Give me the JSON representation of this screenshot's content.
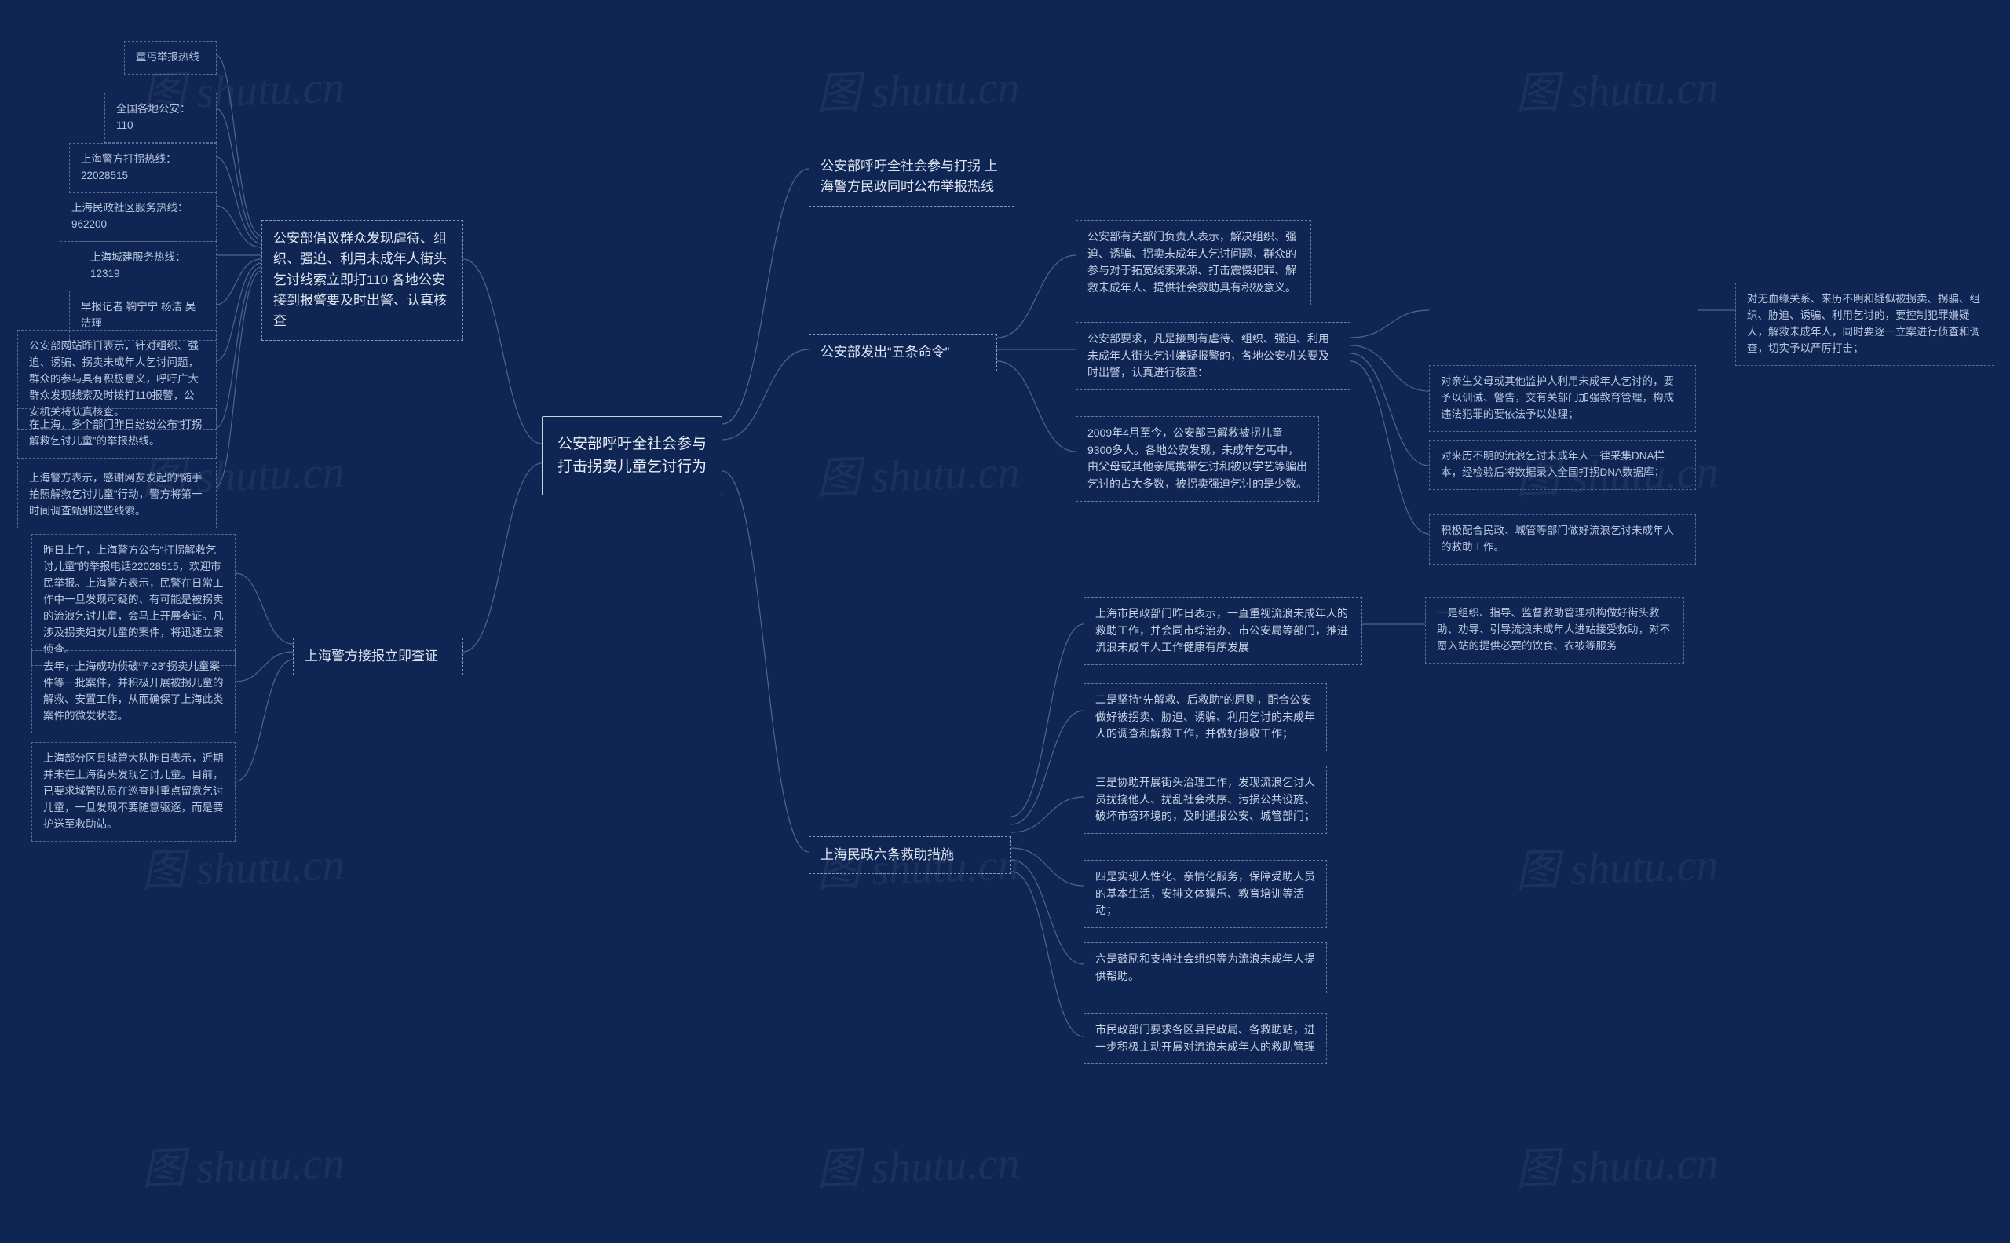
{
  "watermark": "图 shutu.cn",
  "center": "公安部呼吁全社会参与打击拐卖儿童乞讨行为",
  "left": {
    "branchA": {
      "title": "公安部倡议群众发现虐待、组织、强迫、利用未成年人街头乞讨线索立即打110  各地公安接到报警要及时出警、认真核查",
      "items": [
        "童丐举报热线",
        "全国各地公安：110",
        "上海警方打拐热线：22028515",
        "上海民政社区服务热线：962200",
        "上海城建服务热线：12319",
        "早报记者 鞠宁宁 杨洁 吴洁瑾",
        "公安部网站昨日表示，针对组织、强迫、诱骗、拐卖未成年人乞讨问题，群众的参与具有积极意义，呼吁广大群众发现线索及时拨打110报警，公安机关将认真核查。",
        "在上海，多个部门昨日纷纷公布“打拐解救乞讨儿童”的举报热线。",
        "上海警方表示，感谢网友发起的“随手拍照解救乞讨儿童”行动，警方将第一时间调查甄别这些线索。"
      ]
    },
    "branchB": {
      "title": "上海警方接报立即查证",
      "items": [
        "昨日上午，上海警方公布“打拐解救乞讨儿童”的举报电话22028515，欢迎市民举报。上海警方表示，民警在日常工作中一旦发现可疑的、有可能是被拐卖的流浪乞讨儿童，会马上开展查证。凡涉及拐卖妇女儿童的案件，将迅速立案侦查。",
        "去年，上海成功侦破“7·23”拐卖儿童案件等一批案件，并积极开展被拐儿童的解救、安置工作，从而确保了上海此类案件的微发状态。",
        "上海部分区县城管大队昨日表示，近期并未在上海街头发现乞讨儿童。目前，已要求城管队员在巡查时重点留意乞讨儿童，一旦发现不要随意驱逐，而是要护送至救助站。"
      ]
    }
  },
  "right": {
    "branchC": {
      "title": "公安部呼吁全社会参与打拐 上海警方民政同时公布举报热线"
    },
    "branchD": {
      "title": "公安部发出“五条命令”",
      "items": [
        "公安部有关部门负责人表示，解决组织、强迫、诱骗、拐卖未成年人乞讨问题，群众的参与对于拓宽线索来源、打击震慑犯罪、解救未成年人、提供社会救助具有积极意义。",
        "2009年4月至今，公安部已解救被拐儿童9300多人。各地公安发现，未成年乞丐中，由父母或其他亲属携带乞讨和被以学艺等骗出乞讨的占大多数，被拐卖强迫乞讨的是少数。"
      ],
      "sub": {
        "lead": "公安部要求，凡是接到有虐待、组织、强迫、利用未成年人街头乞讨嫌疑报警的，各地公安机关要及时出警，认真进行核查：",
        "leaves": [
          "对无血缘关系、来历不明和疑似被拐卖、拐骗、组织、胁迫、诱骗、利用乞讨的，要控制犯罪嫌疑人，解救未成年人，同时要逐一立案进行侦查和调查，切实予以严厉打击；",
          "对亲生父母或其他监护人利用未成年人乞讨的，要予以训诫、警告，交有关部门加强教育管理，构成违法犯罪的要依法予以处理；",
          "对来历不明的流浪乞讨未成年人一律采集DNA样本，经检验后将数据录入全国打拐DNA数据库；",
          "积极配合民政、城管等部门做好流浪乞讨未成年人的救助工作。"
        ]
      }
    },
    "branchE": {
      "title": "上海民政六条救助措施",
      "items": [
        "二是坚持“先解救、后救助”的原则，配合公安做好被拐卖、胁迫、诱骗、利用乞讨的未成年人的调查和解救工作，并做好接收工作；",
        "三是协助开展街头治理工作，发现流浪乞讨人员扰挠他人、扰乱社会秩序、污损公共设施、破坏市容环境的，及时通报公安、城管部门；",
        "四是实现人性化、亲情化服务，保障受助人员的基本生活，安排文体娱乐、教育培训等活动；",
        "六是鼓励和支持社会组织等为流浪未成年人提供帮助。",
        "市民政部门要求各区县民政局、各救助站，进一步积极主动开展对流浪未成年人的救助管理"
      ],
      "sub": {
        "lead": "上海市民政部门昨日表示，一直重视流浪未成年人的救助工作，并会同市综治办、市公安局等部门，推进流浪未成年人工作健康有序发展",
        "leaf": "一是组织、指导、监督救助管理机构做好街头救助、劝导、引导流浪未成年人进站接受救助，对不愿入站的提供必要的饮食、衣被等服务"
      }
    }
  }
}
